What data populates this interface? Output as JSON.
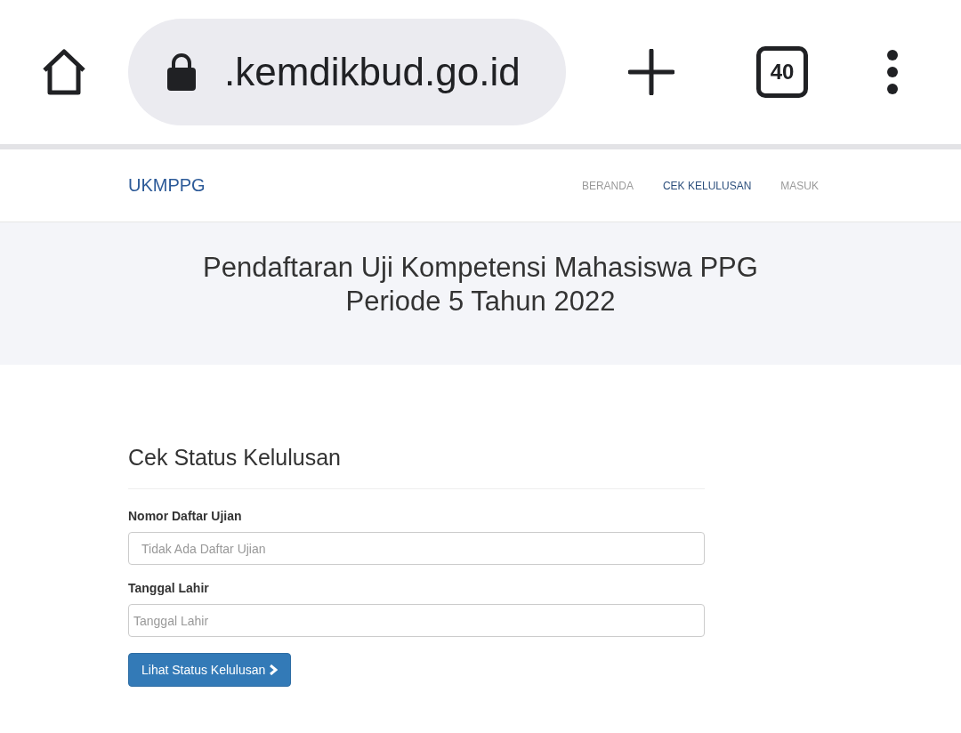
{
  "browser": {
    "url": ".kemdikbud.go.id",
    "tab_count": "40"
  },
  "navbar": {
    "brand": "UKMPPG",
    "items": [
      {
        "label": "BERANDA",
        "selected": false
      },
      {
        "label": "CEK KELULUSAN",
        "selected": true
      },
      {
        "label": "MASUK",
        "selected": false
      }
    ]
  },
  "hero": {
    "title_lines": [
      "Pendaftaran Uji Kompetensi Mahasiswa PPG",
      "Periode 5 Tahun 2022"
    ]
  },
  "form": {
    "heading": "Cek Status Kelulusan",
    "fields": [
      {
        "label": "Nomor Daftar Ujian",
        "placeholder": "Tidak Ada Daftar Ujian",
        "kind": "text"
      },
      {
        "label": "Tanggal Lahir",
        "placeholder": "Tanggal Lahir",
        "kind": "date"
      }
    ],
    "button": "Lihat Status Kelulusan"
  }
}
